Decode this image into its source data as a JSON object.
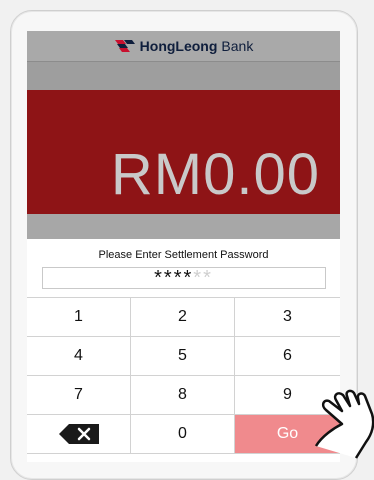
{
  "header": {
    "brand_bold": "HongLeong",
    "brand_light": "Bank"
  },
  "amount": "RM0.00",
  "password": {
    "label": "Please Enter Settlement Password",
    "filled": "****",
    "empty": "**"
  },
  "keypad": {
    "keys": [
      "1",
      "2",
      "3",
      "4",
      "5",
      "6",
      "7",
      "8",
      "9"
    ],
    "zero": "0",
    "go": "Go"
  },
  "colors": {
    "brand_red": "#8e1416",
    "go_button": "#f08a8d",
    "header_gray": "#a9a9a9"
  },
  "icons": {
    "logo": "hongleong-logo-icon",
    "backspace": "backspace-icon",
    "pointer": "hand-pointer-icon"
  }
}
